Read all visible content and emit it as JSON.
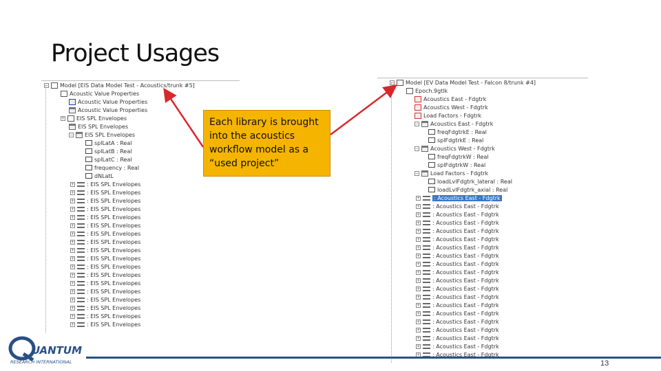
{
  "slide": {
    "title": "Project Usages",
    "callout": "Each library is brought into the acoustics workflow model as a “used project”",
    "page_number": "13"
  },
  "logo": {
    "word": "UANTUM",
    "tag": "RESEARCH INTERNATIONAL",
    "accent": "#2a4f86"
  },
  "colors": {
    "callout_bg": "#f5b400",
    "arrow": "#d9282b",
    "footer_bar": "#2a4f86",
    "selection": "#3b74c9"
  },
  "left_tree": {
    "root": "Model [EIS Data Model Test - Acoustics/trunk #5]",
    "items": [
      "Acoustic Value Properties",
      "Acoustic Value Properties",
      "Acoustic Value Properties",
      "EIS SPL Envelopes",
      "EIS SPL Envelopes",
      "EIS SPL Envelopes",
      "splLatA : Real",
      "splLatB : Real",
      "splLatC : Real",
      "frequency : Real",
      "dNLatL",
      ": EIS SPL Envelopes",
      ": EIS SPL Envelopes",
      ": EIS SPL Envelopes",
      ": EIS SPL Envelopes",
      ": EIS SPL Envelopes",
      ": EIS SPL Envelopes",
      ": EIS SPL Envelopes",
      ": EIS SPL Envelopes",
      ": EIS SPL Envelopes",
      ": EIS SPL Envelopes",
      ": EIS SPL Envelopes",
      ": EIS SPL Envelopes",
      ": EIS SPL Envelopes",
      ": EIS SPL Envelopes",
      ": EIS SPL Envelopes",
      ": EIS SPL Envelopes",
      ": EIS SPL Envelopes",
      ": EIS SPL Envelopes"
    ]
  },
  "right_tree": {
    "root": "Model [EV Data Model Test - Falcon 8/trunk #4]",
    "items": [
      "Epoch.9gtlk",
      "Acoustics East - Fdgtrk",
      "Acoustics West - Fdgtrk",
      "Load Factors - Fdgtrk",
      "Acoustics East - Fdgtrk",
      "freqFdgtrkE : Real",
      "splFdgtrkE : Real",
      "Acoustics West - Fdgtrk",
      "freqFdgtrkW : Real",
      "splFdgtrkW : Real",
      "Load Factors - Fdgtrk",
      "loadLvlFdgtrk_lateral : Real",
      "loadLvlFdgtrk_axial : Real",
      ": Acoustics East - Fdgtrk",
      ": Acoustics East - Fdgtrk",
      ": Acoustics East - Fdgtrk",
      ": Acoustics East - Fdgtrk",
      ": Acoustics East - Fdgtrk",
      ": Acoustics East - Fdgtrk",
      ": Acoustics East - Fdgtrk",
      ": Acoustics East - Fdgtrk",
      ": Acoustics East - Fdgtrk",
      ": Acoustics East - Fdgtrk",
      ": Acoustics East - Fdgtrk",
      ": Acoustics East - Fdgtrk",
      ": Acoustics East - Fdgtrk",
      ": Acoustics East - Fdgtrk",
      ": Acoustics East - Fdgtrk",
      ": Acoustics East - Fdgtrk",
      ": Acoustics East - Fdgtrk",
      ": Acoustics East - Fdgtrk",
      ": Acoustics East - Fdgtrk",
      ": Acoustics East - Fdgtrk"
    ]
  }
}
